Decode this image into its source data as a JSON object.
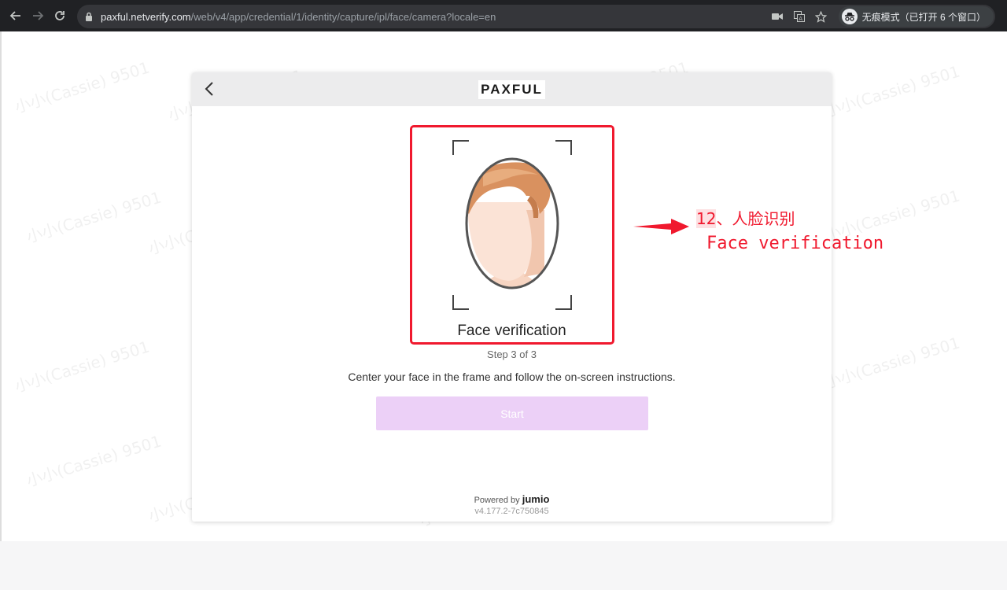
{
  "browser": {
    "url_host": "paxful.netverify.com",
    "url_path": "/web/v4/app/credential/1/identity/capture/ipl/face/camera?locale=en",
    "incognito_label": "无痕模式（已打开 6 个窗口）",
    "icons": {
      "back": "arrow-left-icon",
      "forward": "arrow-right-icon",
      "reload": "reload-icon",
      "lock": "lock-icon",
      "camera": "video-camera-icon",
      "translate": "translate-icon",
      "bookmark": "star-icon",
      "incognito": "incognito-icon"
    }
  },
  "card": {
    "logo": "PAXFUL",
    "title": "Face verification",
    "step": "Step 3 of 3",
    "instructions": "Center your face in the frame and follow the on-screen instructions.",
    "start_label": "Start",
    "powered_prefix": "Powered by",
    "powered_brand": "jumio",
    "version": "v4.177.2-7c750845"
  },
  "annotation": {
    "number": "12",
    "zh_text": "、人脸识别",
    "en_text": "Face verification",
    "color": "#f0192e"
  },
  "watermark": "小小(Cassie) 9501",
  "colors": {
    "start_button": "#ecd0f7",
    "chrome": "#202124"
  }
}
